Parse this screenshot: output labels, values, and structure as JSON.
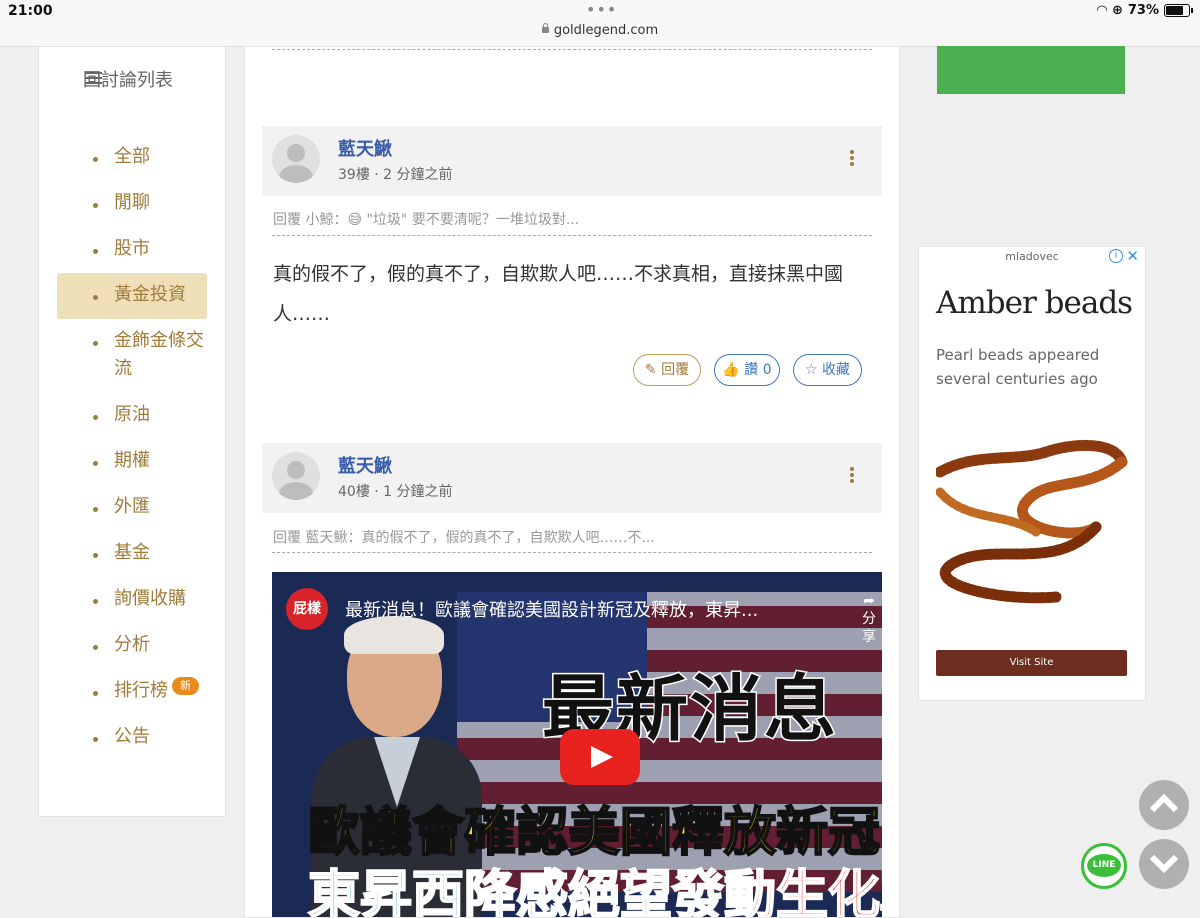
{
  "status_bar": {
    "time": "21:00",
    "url": "goldlegend.com",
    "battery": "73%"
  },
  "sidebar": {
    "title": "回討論列表",
    "items": [
      {
        "label": "全部"
      },
      {
        "label": "閒聊"
      },
      {
        "label": "股市"
      },
      {
        "label": "黃金投資",
        "active": true
      },
      {
        "label": "金飾金條交流"
      },
      {
        "label": "原油"
      },
      {
        "label": "期權"
      },
      {
        "label": "外匯"
      },
      {
        "label": "基金"
      },
      {
        "label": "詢價收購"
      },
      {
        "label": "分析"
      },
      {
        "label": "排行榜",
        "badge": "新"
      },
      {
        "label": "公告"
      }
    ]
  },
  "posts": [
    {
      "username": "藍天鰍",
      "floor_time": "39樓 ·  2 分鐘之前",
      "quote": "回覆 小鯨：😅 \"垃圾\" 要不要清呢？一堆垃圾對...",
      "content": "真的假不了，假的真不了，自欺欺人吧……不求真相，直接抹黑中國人……",
      "reply_label": "回覆",
      "like_label": "讚 0",
      "fav_label": "收藏"
    },
    {
      "username": "藍天鰍",
      "floor_time": "40樓 ·  1 分鐘之前",
      "quote": "回覆 藍天鰍：真的假不了，假的真不了，自欺欺人吧……不..."
    }
  ],
  "video": {
    "channel_logo": "屁樣",
    "title": "最新消息！歐議會確認美國設計新冠及釋放，東昇...",
    "share_label": "分享",
    "big_text": "最新消息",
    "headline1": "歐議會確認美國釋放新冠",
    "headline2_a": "東昇西降感絕望",
    "headline2_b": "發動生化戰"
  },
  "ad": {
    "advertiser": "mladovec",
    "title": "Amber beads",
    "subtitle": "Pearl beads appeared several centuries ago",
    "button": "Visit Site"
  },
  "floating": {
    "line_label": "LINE"
  }
}
